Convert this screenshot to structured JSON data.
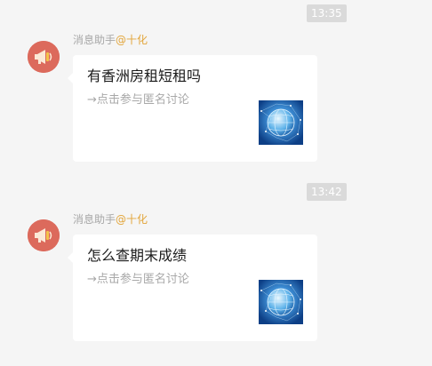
{
  "messages": [
    {
      "timestamp": "13:35",
      "sender_name": "消息助手",
      "sender_mention": "@十化",
      "title": "有香洲房租短租吗",
      "link_text": "→点击参与匿名讨论",
      "avatar_icon": "megaphone-icon",
      "thumbnail_icon": "globe-network-icon"
    },
    {
      "timestamp": "13:42",
      "sender_name": "消息助手",
      "sender_mention": "@十化",
      "title": "怎么查期末成绩",
      "link_text": "→点击参与匿名讨论",
      "avatar_icon": "megaphone-icon",
      "thumbnail_icon": "globe-network-icon"
    }
  ],
  "colors": {
    "background": "#f5f5f5",
    "timestamp_bg": "#dadada",
    "avatar_bg": "#dc6a5c",
    "mention": "#e2a53a",
    "sender": "#a7a7a7",
    "card_bg": "#ffffff"
  }
}
